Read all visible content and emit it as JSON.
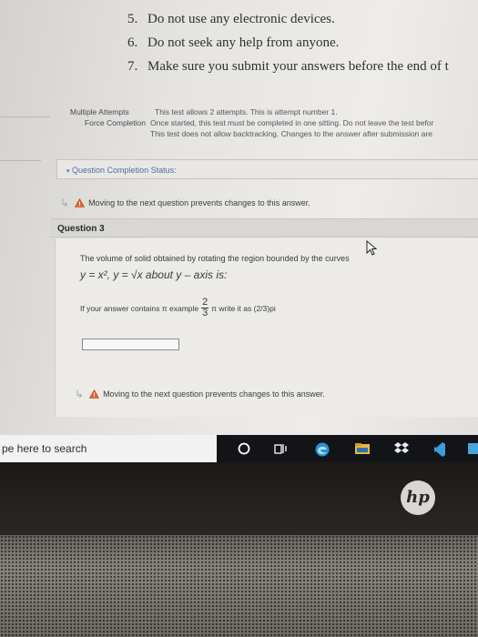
{
  "instructions": [
    {
      "num": "5.",
      "text": "Do not use any electronic devices."
    },
    {
      "num": "6.",
      "text": "Do not seek any help from anyone."
    },
    {
      "num": "7.",
      "text": "Make sure you submit your answers before the end of t"
    }
  ],
  "test_info": {
    "multiple_attempts_label": "Multiple Attempts",
    "multiple_attempts_text": "This test allows 2 attempts. This is attempt number 1.",
    "force_completion_label": "Force Completion",
    "force_completion_text": "Once started, this test must be completed in one sitting. Do not leave the test befor",
    "backtrack_text": "This test does not allow backtracking. Changes to the answer after submission are"
  },
  "question_completion_status": "Question Completion Status:",
  "warning_text": "Moving to the next question prevents changes to this answer.",
  "question": {
    "title": "Question 3",
    "prompt": "The volume of solid obtained by rotating the region bounded by the curves",
    "math": "y = x², y = √x about y – axis is:",
    "hint_prefix": "If your answer contains π example",
    "frac_num": "2",
    "frac_den": "3",
    "hint_suffix": "π write it as (2/3)pi",
    "answer_value": ""
  },
  "taskbar": {
    "search_placeholder": "pe here to search"
  },
  "brand": "hp",
  "colors": {
    "link_blue": "#4b6fa8",
    "warning_orange": "#e0642a",
    "taskbar": "#121418"
  }
}
